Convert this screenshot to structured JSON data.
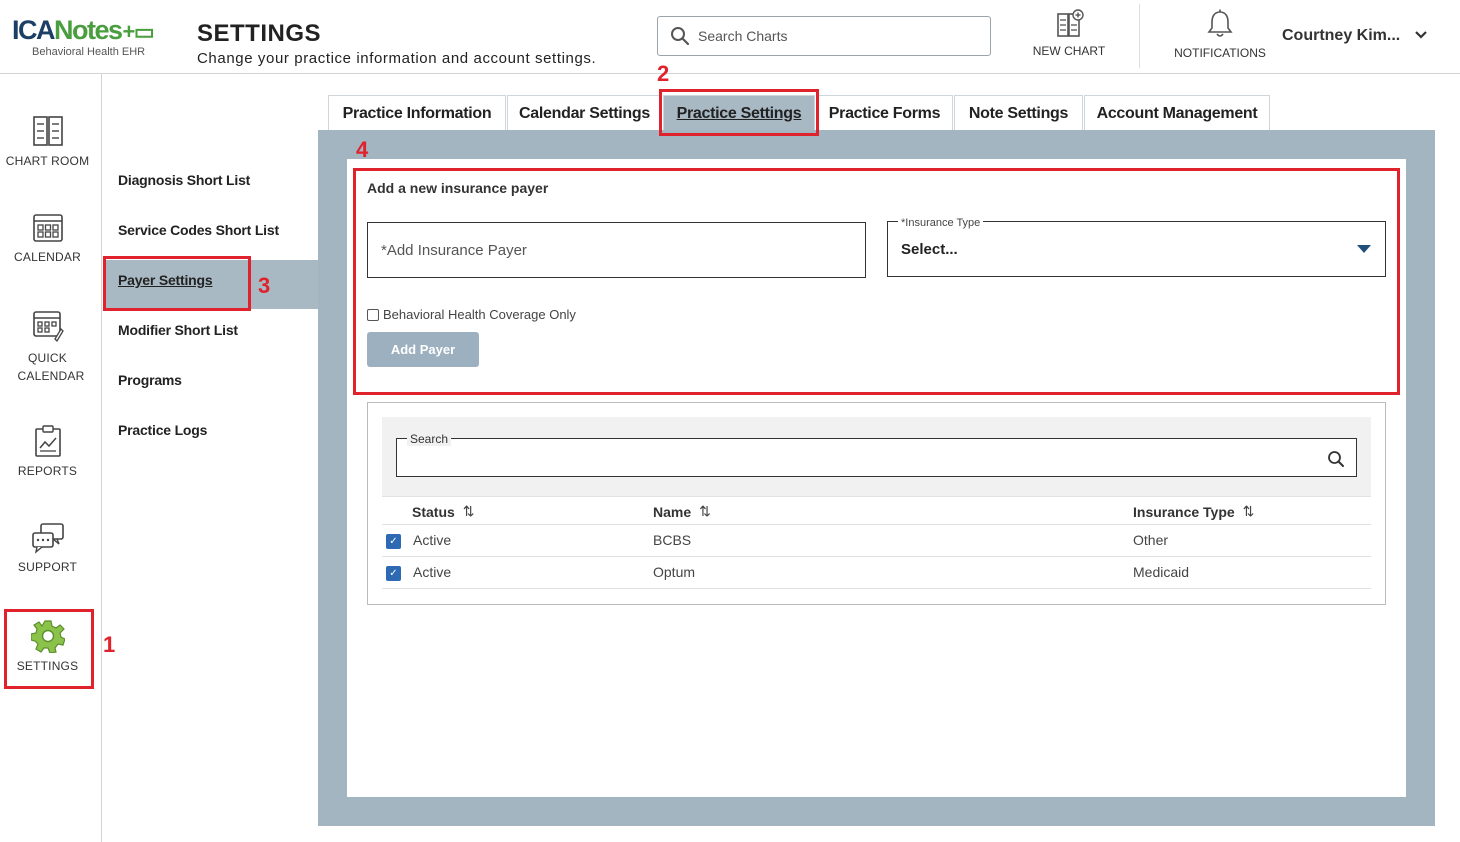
{
  "header": {
    "logo_main": "ICANotes",
    "logo_sub": "Behavioral Health EHR",
    "title": "SETTINGS",
    "subtitle": "Change your practice information and account settings.",
    "search_placeholder": "Search Charts",
    "new_chart_label": "NEW CHART",
    "notifications_label": "NOTIFICATIONS",
    "user_name": "Courtney Kim..."
  },
  "leftnav": {
    "items": [
      {
        "label": "CHART ROOM",
        "icon": "chart-room-icon"
      },
      {
        "label": "CALENDAR",
        "icon": "calendar-icon"
      },
      {
        "label": "QUICK CALENDAR",
        "icon": "quick-calendar-icon"
      },
      {
        "label": "REPORTS",
        "icon": "reports-icon"
      },
      {
        "label": "SUPPORT",
        "icon": "support-icon"
      },
      {
        "label": "SETTINGS",
        "icon": "gear-icon"
      }
    ]
  },
  "submenu": {
    "items": [
      {
        "label": "Diagnosis Short List"
      },
      {
        "label": "Service Codes Short List"
      },
      {
        "label": "Payer Settings",
        "active": true
      },
      {
        "label": "Modifier Short List"
      },
      {
        "label": "Programs"
      },
      {
        "label": "Practice Logs"
      }
    ]
  },
  "tabs": [
    {
      "label": "Practice Information"
    },
    {
      "label": "Calendar Settings"
    },
    {
      "label": "Practice Settings",
      "active": true
    },
    {
      "label": "Practice Forms"
    },
    {
      "label": "Note Settings"
    },
    {
      "label": "Account Management"
    }
  ],
  "form": {
    "title": "Add a new insurance payer",
    "payer_placeholder": "*Add Insurance Payer",
    "insurance_type_label": "*Insurance Type",
    "insurance_type_value": "Select...",
    "checkbox_label": "Behavioral Health Coverage Only",
    "checkbox_checked": false,
    "add_button": "Add Payer"
  },
  "table": {
    "search_label": "Search",
    "columns": [
      "Status",
      "Name",
      "Insurance Type"
    ],
    "rows": [
      {
        "status": "Active",
        "name": "BCBS",
        "type": "Other",
        "checked": true
      },
      {
        "status": "Active",
        "name": "Optum",
        "type": "Medicaid",
        "checked": true
      }
    ]
  },
  "annotations": [
    "1",
    "2",
    "3",
    "4"
  ],
  "colors": {
    "brand_blue": "#1c3f66",
    "brand_green": "#4a9e3f",
    "annotation_red": "#e0222c",
    "active_bg": "#a9b9c4",
    "checkbox_blue": "#2e6ab4"
  }
}
